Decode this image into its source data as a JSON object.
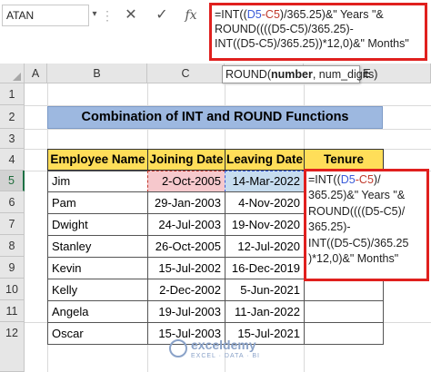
{
  "formula_bar": {
    "name_box": "ATAN",
    "cancel_icon": "✕",
    "enter_icon": "✓",
    "fx_label": "fx"
  },
  "formula": {
    "line1_pre": "=INT((",
    "line1_ref1": "D5",
    "line1_dash": "-",
    "line1_ref2": "C5",
    "line1_post": ")/365.25)&\" Years \"&",
    "line2": "ROUND((((D5-C5)/365.25)-",
    "line3": "INT((D5-C5)/365.25))*12,0)&\" Months\""
  },
  "tooltip": {
    "func": "ROUND(",
    "arg1": "number",
    "rest": ", num_digits)"
  },
  "columns": [
    "A",
    "B",
    "C",
    "D",
    "E"
  ],
  "rows": [
    "1",
    "2",
    "3",
    "4",
    "5",
    "6",
    "7",
    "8",
    "9",
    "10",
    "11",
    "12"
  ],
  "title": "Combination of INT and ROUND Functions",
  "table": {
    "headers": [
      "Employee Name",
      "Joining Date",
      "Leaving Date",
      "Tenure"
    ],
    "rows": [
      {
        "name": "Jim",
        "join": "2-Oct-2005",
        "leave": "14-Mar-2022"
      },
      {
        "name": "Pam",
        "join": "29-Jan-2003",
        "leave": "4-Nov-2020"
      },
      {
        "name": "Dwight",
        "join": "24-Jul-2003",
        "leave": "19-Nov-2020"
      },
      {
        "name": "Stanley",
        "join": "26-Oct-2005",
        "leave": "12-Jul-2020"
      },
      {
        "name": "Kevin",
        "join": "15-Jul-2002",
        "leave": "16-Dec-2019"
      },
      {
        "name": "Kelly",
        "join": "2-Dec-2002",
        "leave": "5-Jun-2021"
      },
      {
        "name": "Angela",
        "join": "19-Jul-2003",
        "leave": "11-Jan-2022"
      },
      {
        "name": "Oscar",
        "join": "15-Jul-2003",
        "leave": "15-Jul-2021"
      }
    ]
  },
  "cell_editor": {
    "l1_pre": "=INT((",
    "l1_ref1": "D5",
    "l1_dash": "-",
    "l1_ref2": "C5",
    "l1_post": ")/",
    "l2": "365.25)&\" Years \"&",
    "l3": "ROUND((((D5-C5)/",
    "l4": "365.25)-",
    "l5": "INT((D5-C5)/365.25",
    "l6": ")*12,0)&\" Months\""
  },
  "watermark": {
    "name": "exceldemy",
    "tagline": "EXCEL · DATA · BI"
  },
  "colors": {
    "title_fill": "#9db8e0",
    "header_fill": "#ffde59",
    "highlight_border": "#e0201e",
    "ref_d5": "#3a5bd9",
    "ref_c5": "#c0392b"
  }
}
